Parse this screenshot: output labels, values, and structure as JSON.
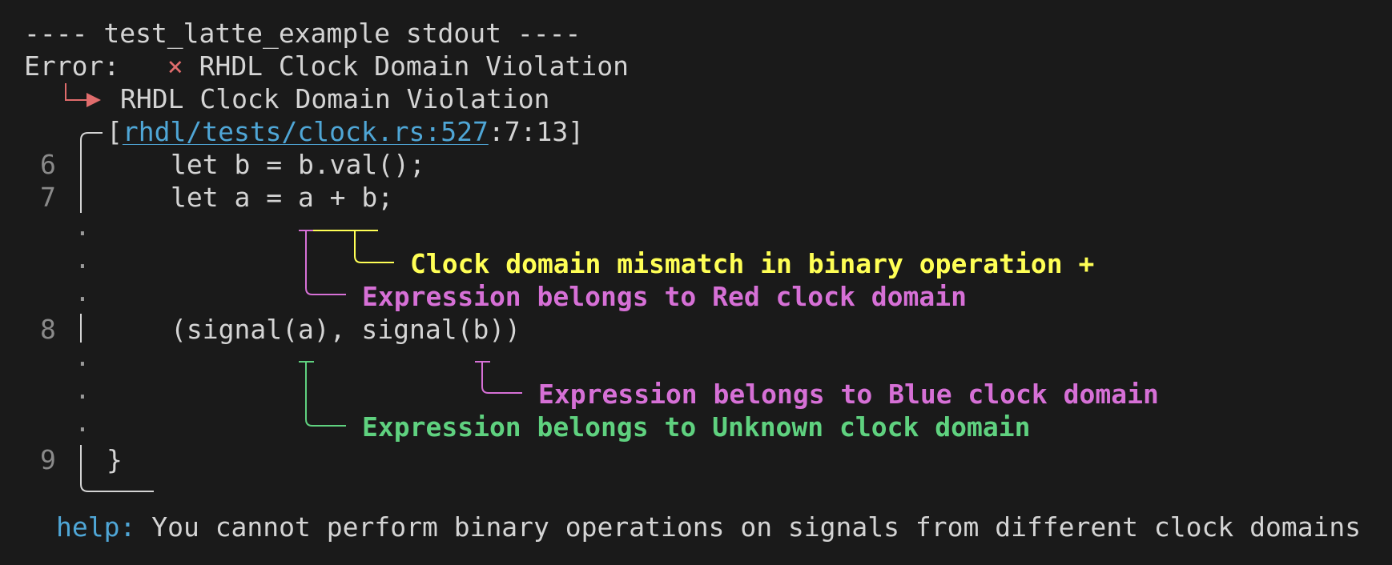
{
  "header": {
    "title": "---- test_latte_example stdout ----"
  },
  "error": {
    "prefix": "Error:",
    "x_glyph": "×",
    "message": "RHDL Clock Domain Violation",
    "sub_message": "RHDL Clock Domain Violation"
  },
  "location": {
    "open_bracket": "[",
    "path": "rhdl/tests/clock.rs:527",
    "position": ":7:13]"
  },
  "code": {
    "line6": {
      "num": "6",
      "text": "let b = b.val();"
    },
    "line7": {
      "num": "7",
      "text": "let a = a + b;"
    },
    "line8": {
      "num": "8",
      "text": "(signal(a), signal(b))"
    },
    "line9": {
      "num": "9",
      "text": "}"
    }
  },
  "dots": ".",
  "annotations": {
    "mismatch": "Clock domain mismatch in binary operation +",
    "red": "Expression belongs to Red clock domain",
    "blue": "Expression belongs to Blue clock domain",
    "unknown": "Expression belongs to Unknown clock domain"
  },
  "help": {
    "label": "help:",
    "text": "You cannot perform binary operations on signals from different clock domains"
  },
  "colors": {
    "background": "#1a1a1a",
    "text": "#d4d4d4",
    "error_red": "#e06c6c",
    "link_blue": "#4fa6d6",
    "yellow": "#ffff55",
    "magenta": "#d670d6",
    "green": "#5fd17f"
  }
}
